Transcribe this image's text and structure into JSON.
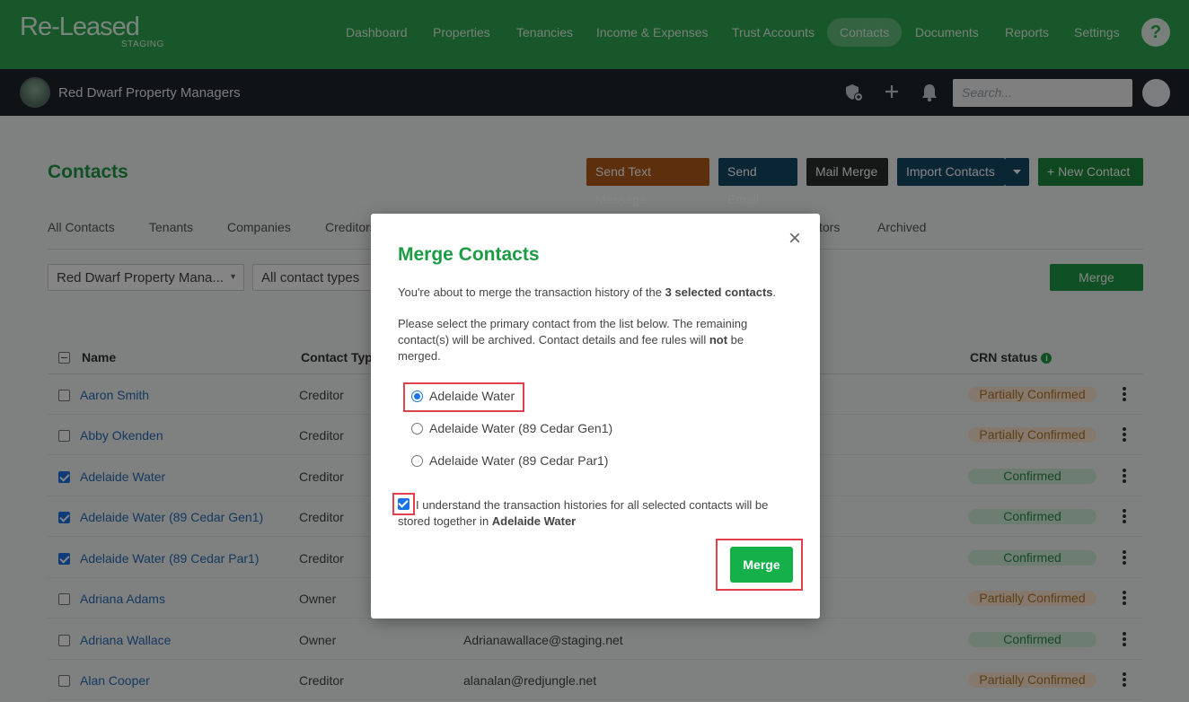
{
  "brand": {
    "name": "Re-Leased",
    "env": "STAGING"
  },
  "nav": {
    "items": [
      {
        "label": "Dashboard"
      },
      {
        "label": "Properties"
      },
      {
        "label": "Tenancies"
      },
      {
        "label": "Income & Expenses"
      },
      {
        "label": "Trust Accounts"
      },
      {
        "label": "Contacts"
      },
      {
        "label": "Documents"
      },
      {
        "label": "Reports"
      },
      {
        "label": "Settings"
      }
    ],
    "active": "Contacts",
    "help_glyph": "?"
  },
  "subheader": {
    "org_name": "Red Dwarf Property Managers",
    "search_placeholder": "Search...",
    "icons": [
      "shield-add-icon",
      "plus-icon",
      "bell-icon"
    ]
  },
  "page": {
    "title": "Contacts",
    "actions": [
      {
        "label": "Send Text Message",
        "color": "#b35a17"
      },
      {
        "label": "Send Email",
        "color": "#144a66"
      },
      {
        "label": "Mail Merge",
        "color": "#2a2f2c"
      },
      {
        "label": "Import Contacts",
        "color": "#144a66"
      },
      {
        "label": "+ New Contact",
        "color": "#1e8a3e"
      }
    ],
    "tabs": [
      "All Contacts",
      "Tenants",
      "Companies",
      "Creditors",
      "tors",
      "Archived"
    ],
    "filters": {
      "org": "Red Dwarf Property Mana...",
      "type": "All contact types"
    },
    "merge_label": "Merge",
    "columns": {
      "name": "Name",
      "type": "Contact Typ",
      "crn": "CRN status"
    },
    "rows": [
      {
        "name": "Aaron Smith",
        "type": "Creditor",
        "email": "",
        "status": "Partially Confirmed",
        "checked": false
      },
      {
        "name": "Abby Okenden",
        "type": "Creditor",
        "email": "",
        "status": "Partially Confirmed",
        "checked": false
      },
      {
        "name": "Adelaide Water",
        "type": "Creditor",
        "email": "",
        "status": "Confirmed",
        "checked": true
      },
      {
        "name": "Adelaide Water (89 Cedar Gen1)",
        "type": "Creditor",
        "email": "",
        "status": "Confirmed",
        "checked": true
      },
      {
        "name": "Adelaide Water (89 Cedar Par1)",
        "type": "Creditor",
        "email": "",
        "status": "Confirmed",
        "checked": true
      },
      {
        "name": "Adriana Adams",
        "type": "Owner",
        "email": "",
        "status": "Partially Confirmed",
        "checked": false
      },
      {
        "name": "Adriana Wallace",
        "type": "Owner",
        "email": "Adrianawallace@staging.net",
        "status": "Confirmed",
        "checked": false
      },
      {
        "name": "Alan Cooper",
        "type": "Creditor",
        "email": "alanalan@redjungle.net",
        "status": "Partially Confirmed",
        "checked": false
      }
    ]
  },
  "modal": {
    "title": "Merge Contacts",
    "close_glyph": "×",
    "p1_before": "You're about to merge the transaction history of the ",
    "p1_bold": "3 selected contacts",
    "p1_after": ".",
    "p2_before": "Please select the primary contact from the list below. The remaining contact(s) will be archived. Contact details and fee rules will ",
    "p2_bold": "not",
    "p2_after": " be merged.",
    "options": [
      {
        "label": "Adelaide Water",
        "selected": true
      },
      {
        "label": "Adelaide Water (89 Cedar Gen1)",
        "selected": false
      },
      {
        "label": "Adelaide Water (89 Cedar Par1)",
        "selected": false
      }
    ],
    "confirm_before": "I understand the transaction histories for all selected contacts will be stored together in ",
    "confirm_bold": "Adelaide Water",
    "confirm_checked": true,
    "merge_label": "Merge"
  }
}
